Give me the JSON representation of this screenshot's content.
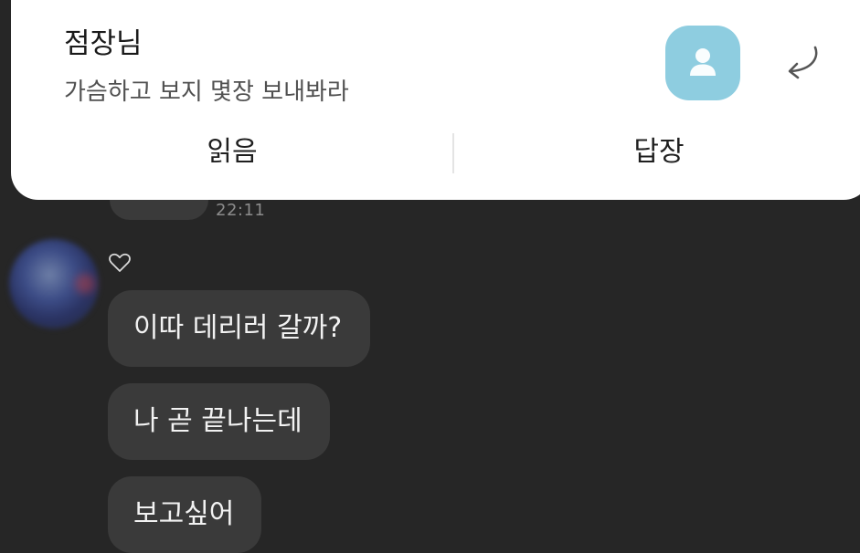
{
  "notification": {
    "sender": "점장님",
    "message": "가슴하고 보지 몇장 보내봐라",
    "actions": {
      "read_label": "읽음",
      "reply_label": "답장"
    },
    "avatar_icon": "person-icon",
    "avatar_color": "#8ecde0",
    "reply_icon": "reply-arrow-icon"
  },
  "chat": {
    "timestamp": "22:11",
    "heart_icon": "heart-outline-icon",
    "messages": [
      "이따 데리러 갈까?",
      "나 곧 끝나는데",
      "보고싶어"
    ]
  }
}
